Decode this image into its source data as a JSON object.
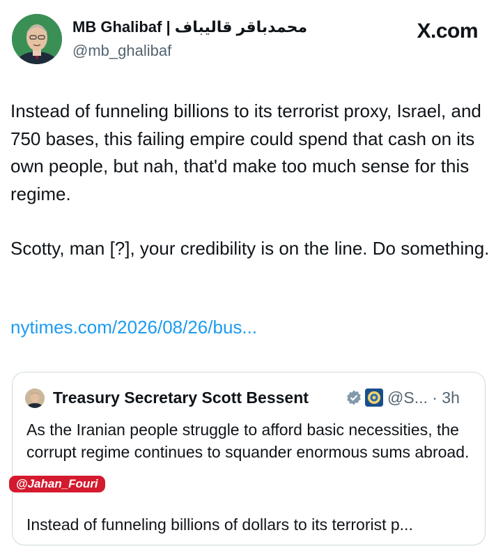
{
  "post": {
    "author_name": "MB Ghalibaf | محمدباقر قالیباف",
    "author_handle": "@mb_ghalibaf",
    "brand": "X.com",
    "paragraphs": [
      "Instead of funneling billions to its terrorist proxy, Israel, and 750 bases, this failing empire could spend that cash on its own people, but nah, that'd make too much sense for this regime.",
      "Scotty, man [?], your credibility is on the line. Do something."
    ],
    "link_text": "nytimes.com/2026/08/26/bus..."
  },
  "quoted_post": {
    "author_name": "Treasury Secretary Scott Bessent",
    "handle_and_time": "@S... · 3h",
    "paragraphs": [
      "As the Iranian people struggle to afford basic necessities, the corrupt regime continues to squander enormous sums abroad.",
      "Instead of funneling billions of dollars to its terrorist p..."
    ]
  },
  "watermark": "@Jahan_Fouri",
  "icons": {
    "brand_logo": "x-logo-icon",
    "verified": "verified-badge-icon",
    "seal": "government-seal-icon"
  },
  "colors": {
    "text": "#0f1419",
    "muted": "#536471",
    "link": "#1d9bf0",
    "border": "#cfd9de",
    "watermark_bg": "#d41a2e"
  }
}
